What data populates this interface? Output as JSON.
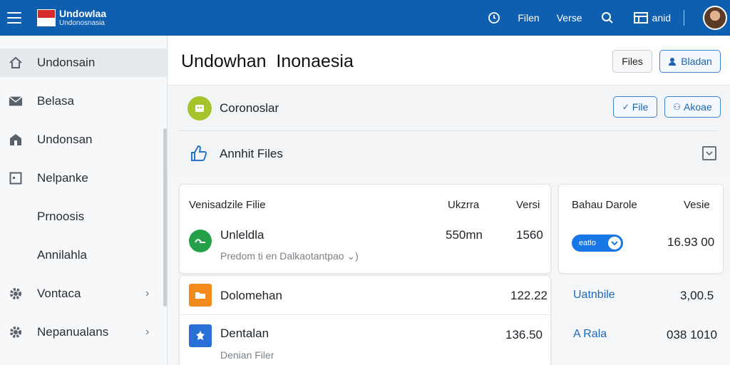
{
  "topbar": {
    "brand_title": "Undowlaa",
    "brand_subtitle": "Undonosnasia",
    "link_1": "Filen",
    "link_2": "Verse",
    "user_label": "anid"
  },
  "sidebar": {
    "items": [
      {
        "label": "Undonsain",
        "icon": "home-icon"
      },
      {
        "label": "Belasa",
        "icon": "mail-icon"
      },
      {
        "label": "Undonsan",
        "icon": "building-icon"
      },
      {
        "label": "Nelpanke",
        "icon": "square-icon"
      },
      {
        "label": "Prnoosis"
      },
      {
        "label": "Annilahla"
      },
      {
        "label": "Vontaca",
        "icon": "gear-icon"
      },
      {
        "label": "Nepanualans",
        "icon": "gear-icon"
      }
    ]
  },
  "header": {
    "title": "Undowhan  Inonaesia",
    "files_button": "Files",
    "bladan_button": "Bladan"
  },
  "section1": {
    "label": "Coronoslar",
    "file_button": "File",
    "akoae_button": "Akoae"
  },
  "section2": {
    "label": "Annhit Files"
  },
  "files_table": {
    "col_name": "Venisadzile Filie",
    "col_size": "Ukzrra",
    "col_version": "Versi",
    "rows": [
      {
        "name": "Unleldla",
        "subtitle": "Predom ti en Dalkaotantpao ⌄)",
        "size": "550mn",
        "version": "1560",
        "icon_color": "#24a148"
      },
      {
        "name": "Dolomehan",
        "subtitle": "",
        "size": "",
        "version": "122.22",
        "icon_color": "#f18b1c"
      },
      {
        "name": "Dentalan",
        "subtitle": "Denian Filer",
        "size": "",
        "version": "136.50",
        "icon_color": "#2a6fd6"
      }
    ]
  },
  "side_table": {
    "col_name": "Bahau Darole",
    "col_version": "Vesie",
    "toggle_label": "eatlo",
    "row1_value": "16.93 00",
    "row2_name": "Uatnbile",
    "row2_value": "3,00.5",
    "row3_name": "A Rala",
    "row3_value": "038 1010"
  }
}
